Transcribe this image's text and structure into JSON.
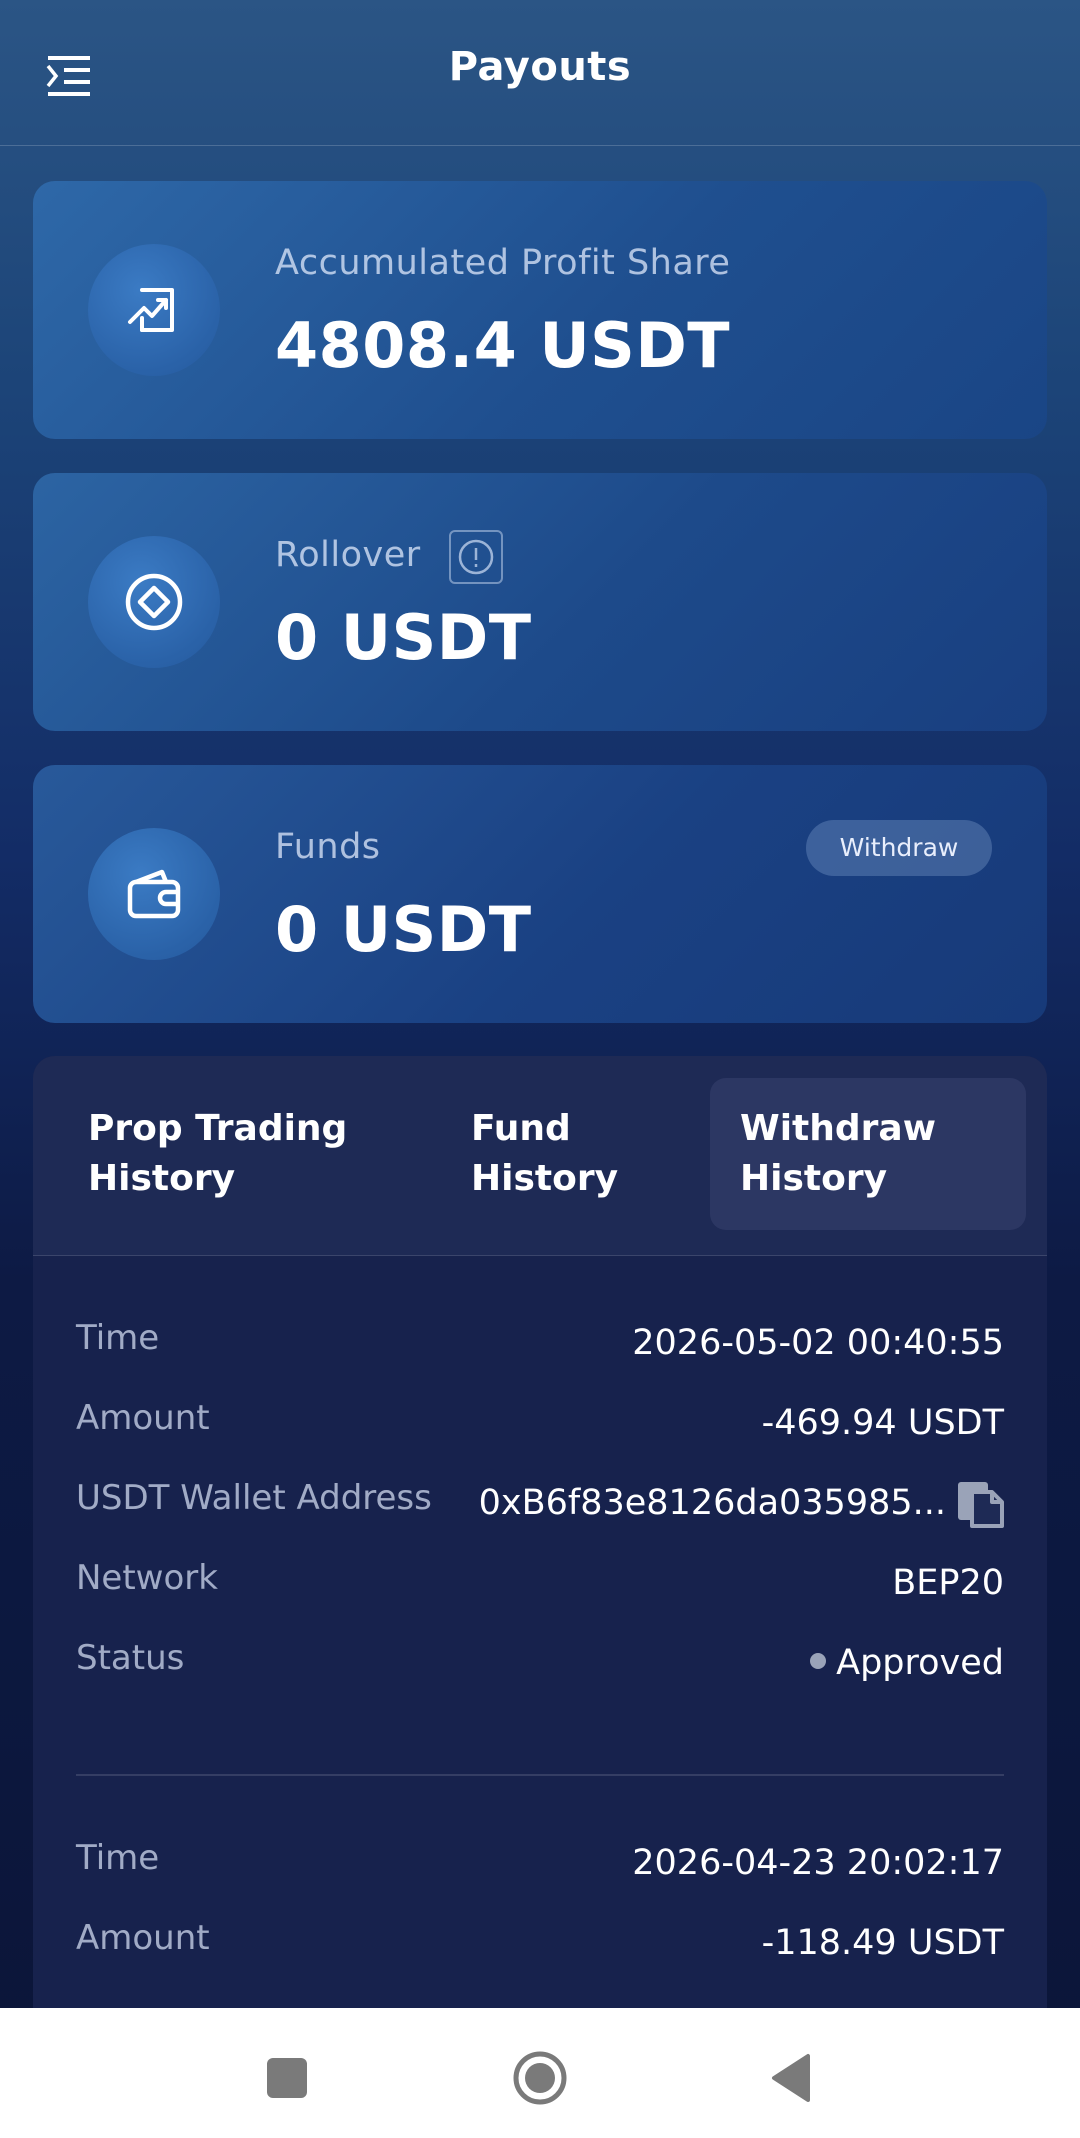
{
  "header": {
    "title": "Payouts",
    "menu_icon": "menu-icon"
  },
  "cards": [
    {
      "label": "Accumulated Profit Share",
      "value": "4808.4 USDT",
      "icon": "chart-icon"
    },
    {
      "label": "Rollover",
      "value": "0 USDT",
      "icon": "diamond-icon",
      "info_icon": "info-icon"
    },
    {
      "label": "Funds",
      "value": "0 USDT",
      "icon": "wallet-icon",
      "action_label": "Withdraw"
    }
  ],
  "tabs": [
    {
      "label_line1": "Prop Trading",
      "label_line2": "History"
    },
    {
      "label_line1": "Fund",
      "label_line2": "History"
    },
    {
      "label_line1": "Withdraw",
      "label_line2": "History",
      "active": true
    }
  ],
  "field_labels": {
    "time": "Time",
    "amount": "Amount",
    "wallet": "USDT Wallet Address",
    "network": "Network",
    "status": "Status"
  },
  "records": [
    {
      "time": "2026-05-02 00:40:55",
      "amount": "-469.94 USDT",
      "wallet": "0xB6f83e8126da035985...",
      "network": "BEP20",
      "status": "Approved"
    },
    {
      "time": "2026-04-23 20:02:17",
      "amount": "-118.49 USDT"
    }
  ],
  "colors": {
    "accent_card": "#2e68a8",
    "panel": "#17224d",
    "status_dot": "#9aa3b8"
  },
  "navbar": {
    "icons": [
      "recent-apps-icon",
      "home-icon",
      "back-icon"
    ]
  }
}
